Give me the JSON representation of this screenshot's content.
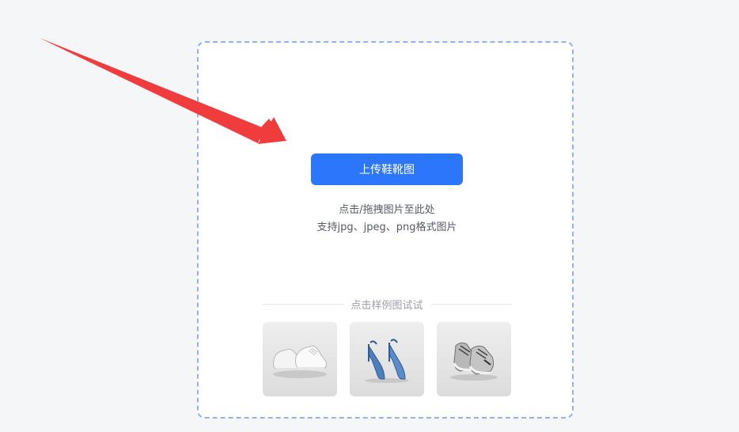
{
  "upload": {
    "button_label": "上传鞋靴图",
    "hint_line1": "点击/拖拽图片至此处",
    "hint_line2": "支持jpg、jpeg、png格式图片"
  },
  "samples": {
    "heading": "点击样例图试试",
    "items": [
      {
        "icon": "white-sneakers-image"
      },
      {
        "icon": "blue-slingback-heels-image"
      },
      {
        "icon": "gray-running-shoes-image"
      }
    ]
  },
  "colors": {
    "primary": "#2b76fb",
    "dashed_border": "#8fb2f6",
    "background": "#f5f6f8",
    "arrow": "#f03c3c"
  }
}
